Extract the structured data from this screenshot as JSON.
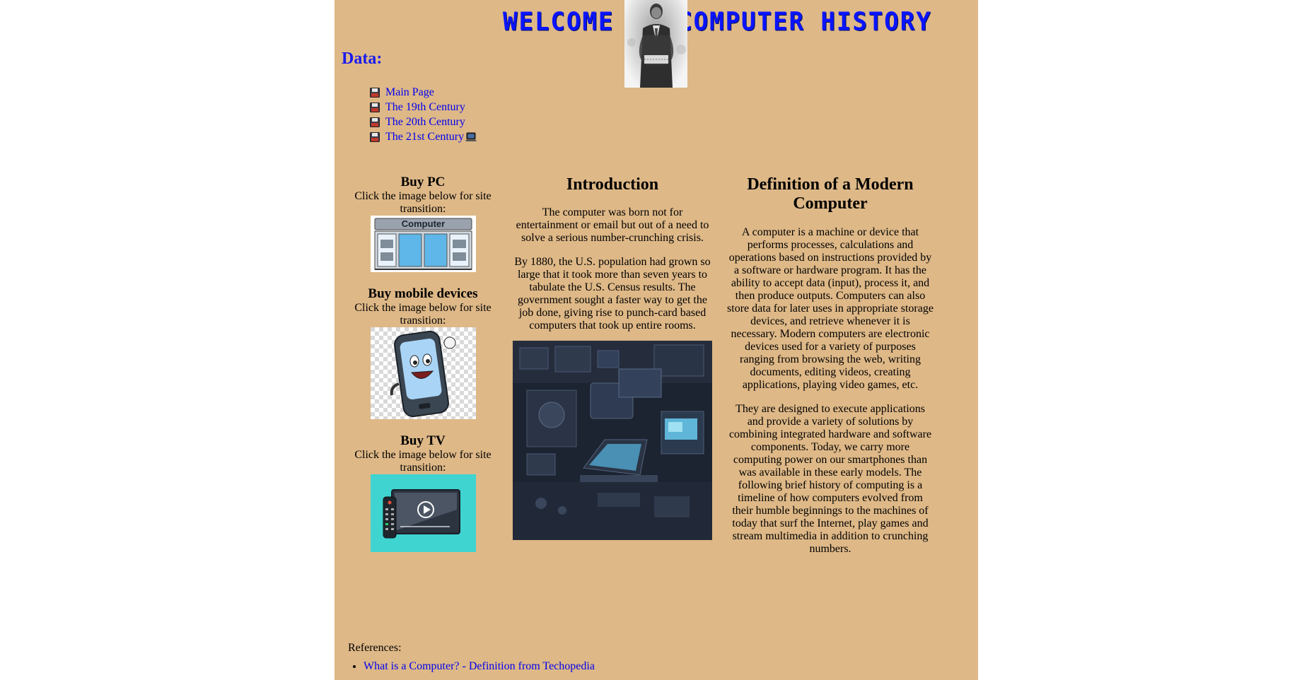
{
  "banner": {
    "title": "WELCOME TO COMPUTER HISTORY"
  },
  "data_heading": "Data:",
  "nav": {
    "items": [
      {
        "label": "Main Page",
        "icon": "floppy-disk-icon"
      },
      {
        "label": "The 19th Century",
        "icon": "floppy-disk-icon"
      },
      {
        "label": "The 20th Century",
        "icon": "floppy-disk-icon"
      },
      {
        "label": "The 21st Century",
        "icon": "floppy-disk-icon",
        "suffix_icon": "laptop-icon"
      }
    ]
  },
  "shop": {
    "sections": [
      {
        "heading": "Buy PC",
        "note": "Click the image below for site transition:",
        "image": "computer-store-image"
      },
      {
        "heading": "Buy mobile devices",
        "note": "Click the image below for site transition:",
        "image": "smartphone-cartoon-image"
      },
      {
        "heading": "Buy TV",
        "note": "Click the image below for site transition:",
        "image": "tv-remote-image"
      }
    ]
  },
  "intro": {
    "heading": "Introduction",
    "paragraphs": [
      "The computer was born not for entertainment or email but out of a need to solve a serious number-crunching crisis.",
      "By 1880, the U.S. population had grown so large that it took more than seven years to tabulate the U.S. Census results. The government sought a faster way to get the job done, giving rise to punch-card based computers that took up entire rooms."
    ]
  },
  "definition": {
    "heading": "Definition of a Modern Computer",
    "paragraphs": [
      "A computer is a machine or device that performs processes, calculations and operations based on instructions provided by a software or hardware program. It has the ability to accept data (input), process it, and then produce outputs. Computers can also store data for later uses in appropriate storage devices, and retrieve whenever it is necessary. Modern computers are electronic devices used for a variety of purposes ranging from browsing the web, writing documents, editing videos, creating applications, playing video games, etc.",
      "They are designed to execute applications and provide a variety of solutions by combining integrated hardware and software components. Today, we carry more computing power on our smartphones than was available in these early models. The following brief history of computing is a timeline of how computers evolved from their humble beginnings to the machines of today that surf the Internet, play games and stream multimedia in addition to crunching numbers."
    ]
  },
  "references": {
    "label": "References:",
    "links": [
      "What is a Computer? - Definition from Techopedia"
    ]
  },
  "colors": {
    "page_background": "#deb887",
    "link": "#0000ee",
    "banner_text": "#0a14ff",
    "tv_background": "#3fd4d0"
  }
}
